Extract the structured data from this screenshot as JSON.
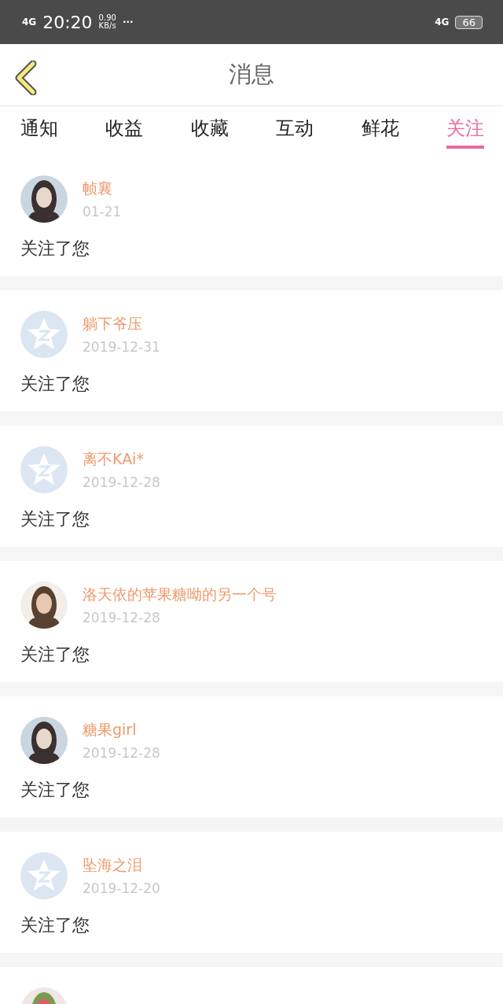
{
  "status_bar": {
    "network": "4G",
    "time": "20:20",
    "speed_value": "0.90",
    "speed_unit": "KB/s",
    "more": "···",
    "network_right": "4G",
    "battery": "66"
  },
  "header": {
    "title": "消息"
  },
  "tabs": [
    {
      "label": "通知",
      "selected": false
    },
    {
      "label": "收益",
      "selected": false
    },
    {
      "label": "收藏",
      "selected": false
    },
    {
      "label": "互动",
      "selected": false
    },
    {
      "label": "鲜花",
      "selected": false
    },
    {
      "label": "关注",
      "selected": true
    }
  ],
  "messages": [
    {
      "name": "帧襄",
      "date": "01-21",
      "text": "关注了您",
      "avatar": {
        "kind": "picture"
      }
    },
    {
      "name": "躺下爷压",
      "date": "2019-12-31",
      "text": "关注了您",
      "avatar": {
        "kind": "default"
      }
    },
    {
      "name": "离不KAi*",
      "date": "2019-12-28",
      "text": "关注了您",
      "avatar": {
        "kind": "default"
      }
    },
    {
      "name": "洛天依的苹果糖呦的另一个号",
      "date": "2019-12-28",
      "text": "关注了您",
      "avatar": {
        "kind": "picture"
      }
    },
    {
      "name": "糖果girl",
      "date": "2019-12-28",
      "text": "关注了您",
      "avatar": {
        "kind": "picture"
      }
    },
    {
      "name": "坠海之泪",
      "date": "2019-12-20",
      "text": "关注了您",
      "avatar": {
        "kind": "default"
      }
    },
    {
      "avatar": {
        "kind": "picture"
      }
    }
  ]
}
